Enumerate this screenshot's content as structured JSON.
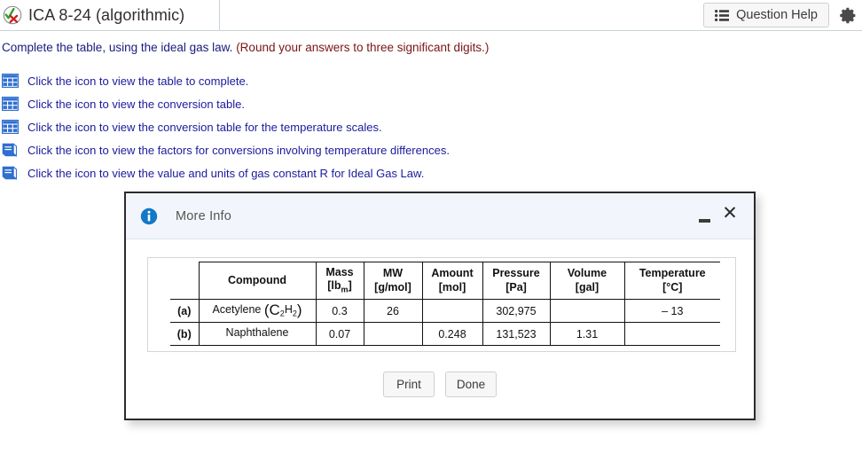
{
  "header": {
    "status_icon": "check-x-icon",
    "title": "ICA 8-24 (algorithmic)",
    "question_help_label": "Question Help",
    "question_help_icon": "list-icon",
    "settings_icon": "gear-icon"
  },
  "question": {
    "prompt_main": "Complete the table, using the ideal gas law.",
    "prompt_note": "(Round your answers to three significant digits.)",
    "links": [
      {
        "icon": "table-grid-icon",
        "text": "Click the icon to view the table to complete."
      },
      {
        "icon": "table-grid-icon",
        "text": "Click the icon to view the conversion table."
      },
      {
        "icon": "table-grid-icon",
        "text": "Click the icon to view the conversion table for the temperature scales."
      },
      {
        "icon": "book-icon",
        "text": "Click the icon to view the factors for conversions involving temperature differences."
      },
      {
        "icon": "book-icon",
        "text": "Click the icon to view the value and units of gas constant R for Ideal Gas Law."
      }
    ]
  },
  "dialog": {
    "icon": "info-icon",
    "title": "More Info",
    "minimize_label": "",
    "close_label": "✕",
    "buttons": {
      "print": "Print",
      "done": "Done"
    },
    "table": {
      "headers": {
        "label": "",
        "compound": "Compound",
        "mass_name": "Mass",
        "mass_units": "[lb",
        "mass_units_sub": "m",
        "mass_units_end": "]",
        "mw_name": "MW",
        "mw_units": "[g/mol]",
        "amount_name": "Amount",
        "amount_units": "[mol]",
        "pressure_name": "Pressure",
        "pressure_units": "[Pa]",
        "volume_name": "Volume",
        "volume_units": "[gal]",
        "temperature_name": "Temperature",
        "temperature_units": "[°C]"
      },
      "rows": [
        {
          "label": "(a)",
          "compound": "Acetylene",
          "formula_pre": "(C",
          "formula_sub1": "2",
          "formula_mid": "H",
          "formula_sub2": "2",
          "formula_post": ")",
          "mass": "0.3",
          "mw": "26",
          "amount": "",
          "pressure": "302,975",
          "volume": "",
          "temperature": "– 13"
        },
        {
          "label": "(b)",
          "compound": "Naphthalene",
          "formula_pre": "",
          "formula_sub1": "",
          "formula_mid": "",
          "formula_sub2": "",
          "formula_post": "",
          "mass": "0.07",
          "mw": "",
          "amount": "0.248",
          "pressure": "131,523",
          "volume": "1.31",
          "temperature": ""
        }
      ]
    }
  },
  "colors": {
    "link_blue": "#1a1a9e",
    "prompt_blue": "#1a1a7e",
    "note_maroon": "#7a1515",
    "dialog_header_bg": "#f2f6fc",
    "info_blue": "#1478c8",
    "icon_blue": "#2f6fd0"
  }
}
